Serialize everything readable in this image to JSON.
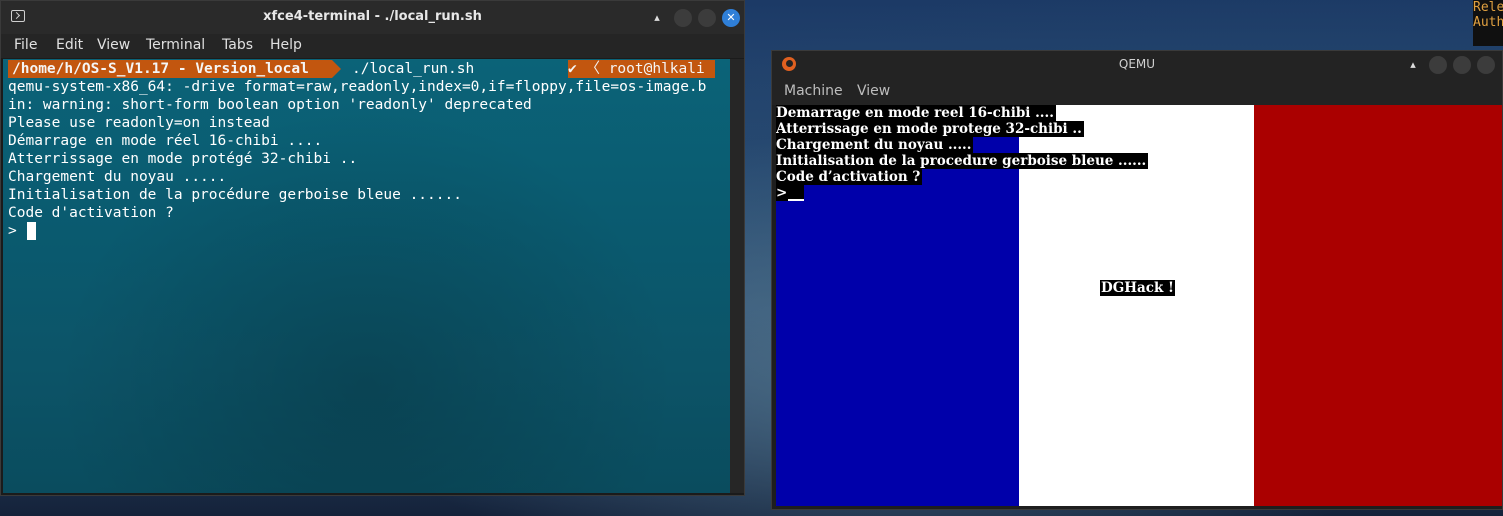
{
  "terminal": {
    "title": "xfce4-terminal - ./local_run.sh",
    "menu": [
      "File",
      "Edit",
      "View",
      "Terminal",
      "Tabs",
      "Help"
    ],
    "prompt": {
      "path": "/home/h/OS-S_V1.17 - Version_local",
      "command": "./local_run.sh",
      "right": "✔ 〈 root@hlkali"
    },
    "lines": [
      "qemu-system-x86_64: -drive format=raw,readonly,index=0,if=floppy,file=os-image.b",
      "in: warning: short-form boolean option 'readonly' deprecated",
      "Please use readonly=on instead",
      "Démarrage en mode réel 16-chibi ....",
      "Atterrissage en mode protégé 32-chibi ..",
      "Chargement du noyau .....",
      "Initialisation de la procédure gerboise bleue ......",
      "Code d'activation ?",
      "> "
    ],
    "window_buttons": {
      "minimize": "",
      "maximize": "",
      "close": "✕"
    },
    "up_glyph": "▴"
  },
  "qemu": {
    "title": "QEMU",
    "menu": [
      "Machine",
      "View"
    ],
    "up_glyph": "▴",
    "screen_lines": [
      "Demarrage en mode reel 16-chibi ....",
      "Atterrissage en mode protege 32-chibi ..",
      "Chargement du noyau .....",
      "Initialisation de la procedure gerboise bleue ......",
      "Code d’activation ?",
      ">"
    ],
    "center_text": "DGHack !",
    "flag_colors": {
      "blue": "#0000aa",
      "white": "#ffffff",
      "red": "#aa0000"
    }
  },
  "right_panel": {
    "lines": [
      "Rele",
      "Auth"
    ]
  }
}
